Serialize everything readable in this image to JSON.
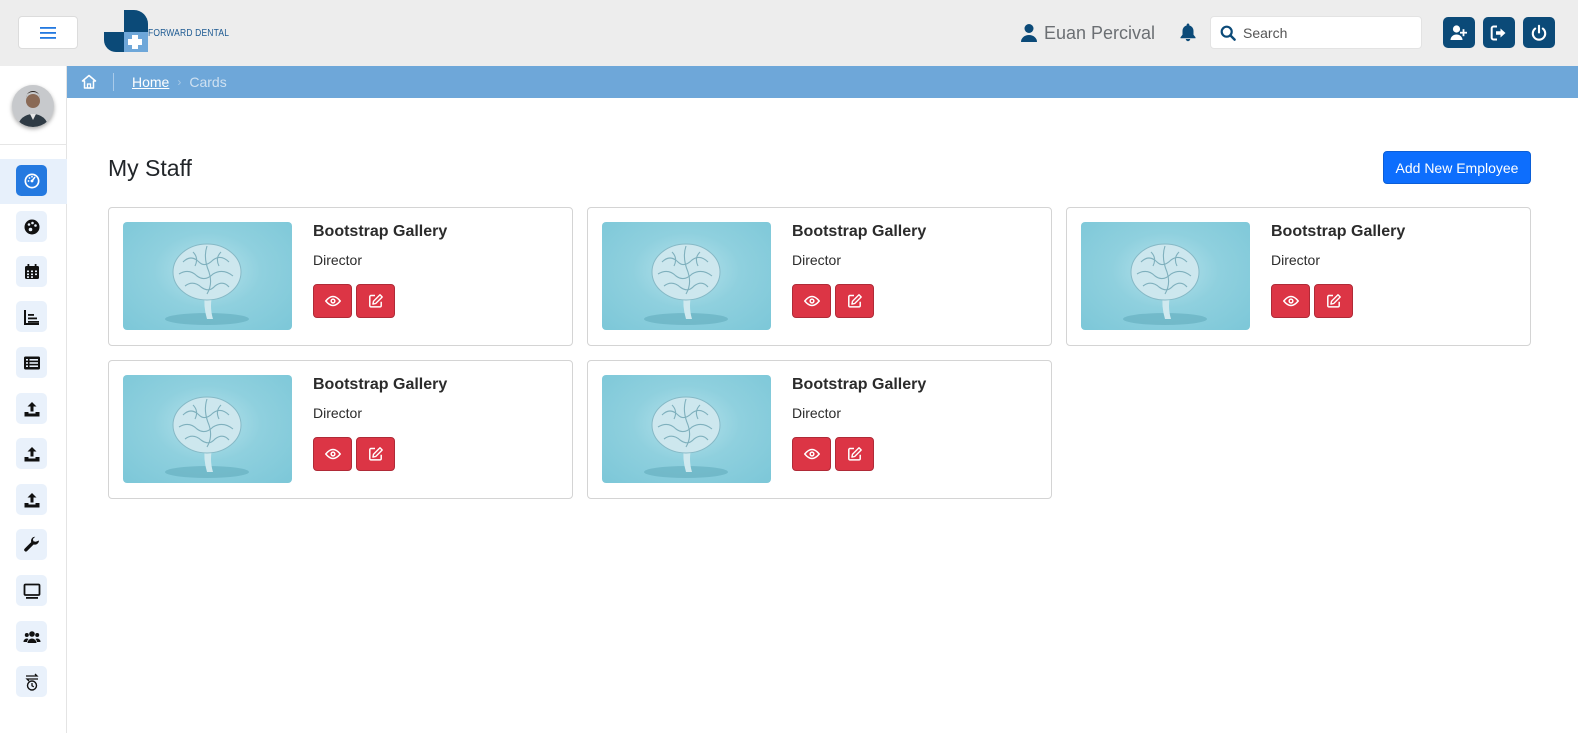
{
  "header": {
    "logo_text": "FORWARD DENTAL",
    "user_name": "Euan Percival",
    "search": {
      "placeholder": "Search",
      "value": ""
    },
    "actions": [
      {
        "name": "add-user-button",
        "icon": "user-plus-icon"
      },
      {
        "name": "logout-button",
        "icon": "sign-out-icon"
      },
      {
        "name": "power-button",
        "icon": "power-icon"
      }
    ]
  },
  "sidebar": {
    "items": [
      {
        "name": "sidebar-item-dashboard",
        "icon": "gauge-icon",
        "active": true
      },
      {
        "name": "sidebar-item-palette",
        "icon": "palette-icon",
        "active": false
      },
      {
        "name": "sidebar-item-calendar",
        "icon": "calendar-icon",
        "active": false
      },
      {
        "name": "sidebar-item-charts",
        "icon": "chart-line-icon",
        "active": false
      },
      {
        "name": "sidebar-item-list",
        "icon": "list-icon",
        "active": false
      },
      {
        "name": "sidebar-item-upload-1",
        "icon": "upload-icon",
        "active": false
      },
      {
        "name": "sidebar-item-upload-2",
        "icon": "upload-icon",
        "active": false
      },
      {
        "name": "sidebar-item-upload-3",
        "icon": "upload-icon",
        "active": false
      },
      {
        "name": "sidebar-item-tools",
        "icon": "wrench-icon",
        "active": false
      },
      {
        "name": "sidebar-item-display",
        "icon": "monitor-icon",
        "active": false
      },
      {
        "name": "sidebar-item-users",
        "icon": "users-icon",
        "active": false
      },
      {
        "name": "sidebar-item-history",
        "icon": "clock-arrows-icon",
        "active": false
      }
    ]
  },
  "breadcrumb": {
    "home_label": "Home",
    "current": "Cards"
  },
  "main": {
    "title": "My Staff",
    "add_button_label": "Add New Employee",
    "cards": [
      {
        "name": "Bootstrap Gallery",
        "role": "Director"
      },
      {
        "name": "Bootstrap Gallery",
        "role": "Director"
      },
      {
        "name": "Bootstrap Gallery",
        "role": "Director"
      },
      {
        "name": "Bootstrap Gallery",
        "role": "Director"
      },
      {
        "name": "Bootstrap Gallery",
        "role": "Director"
      }
    ]
  },
  "colors": {
    "brand": "#0b4a78",
    "accent": "#0d6efd",
    "danger": "#dc3545",
    "breadcrumb_bar": "#6ea7d9"
  }
}
